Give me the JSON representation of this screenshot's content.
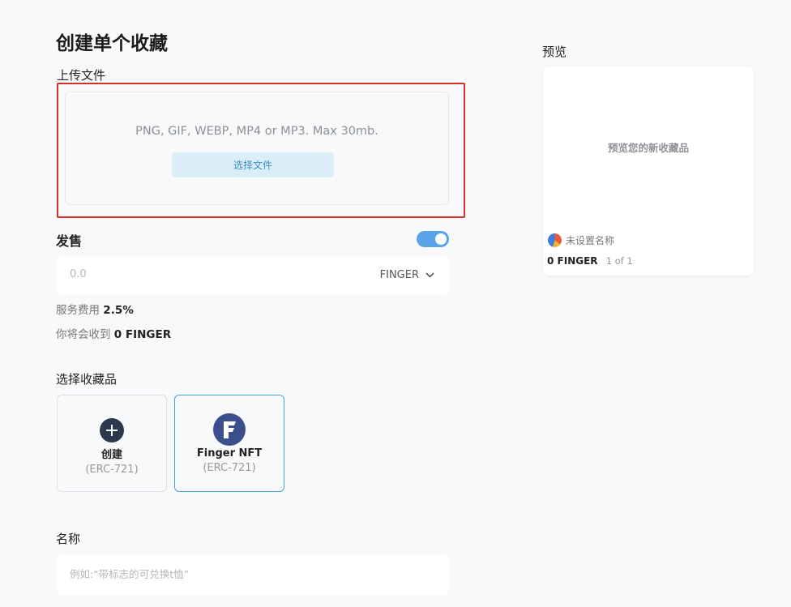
{
  "page": {
    "title": "创建单个收藏"
  },
  "upload": {
    "label": "上传文件",
    "hint": "PNG, GIF, WEBP, MP4 or MP3. Max 30mb.",
    "button": "选择文件"
  },
  "sale": {
    "label": "发售",
    "toggle_on": true,
    "price_placeholder": "0.0",
    "currency": "FINGER",
    "fee_label": "服务费用",
    "fee_value": "2.5%",
    "receive_label": "你将会收到",
    "receive_value": "0 FINGER"
  },
  "collections": {
    "label": "选择收藏品",
    "items": [
      {
        "name": "创建",
        "standard": "(ERC-721)",
        "icon": "plus-icon"
      },
      {
        "name": "Finger NFT",
        "standard": "(ERC-721)",
        "icon": "finger-logo-icon",
        "selected": true
      }
    ]
  },
  "name": {
    "label": "名称",
    "placeholder": "例如:“带标志的可兑换t恤”"
  },
  "preview": {
    "label": "预览",
    "hint": "预览您的新收藏品",
    "owner": "未设置名称",
    "price": "0 FINGER",
    "edition": "1 of 1"
  },
  "colors": {
    "accent": "#5aa3e8",
    "highlight": "#d93025",
    "button_bg": "#d9eef7",
    "button_text": "#3b8fc3"
  }
}
